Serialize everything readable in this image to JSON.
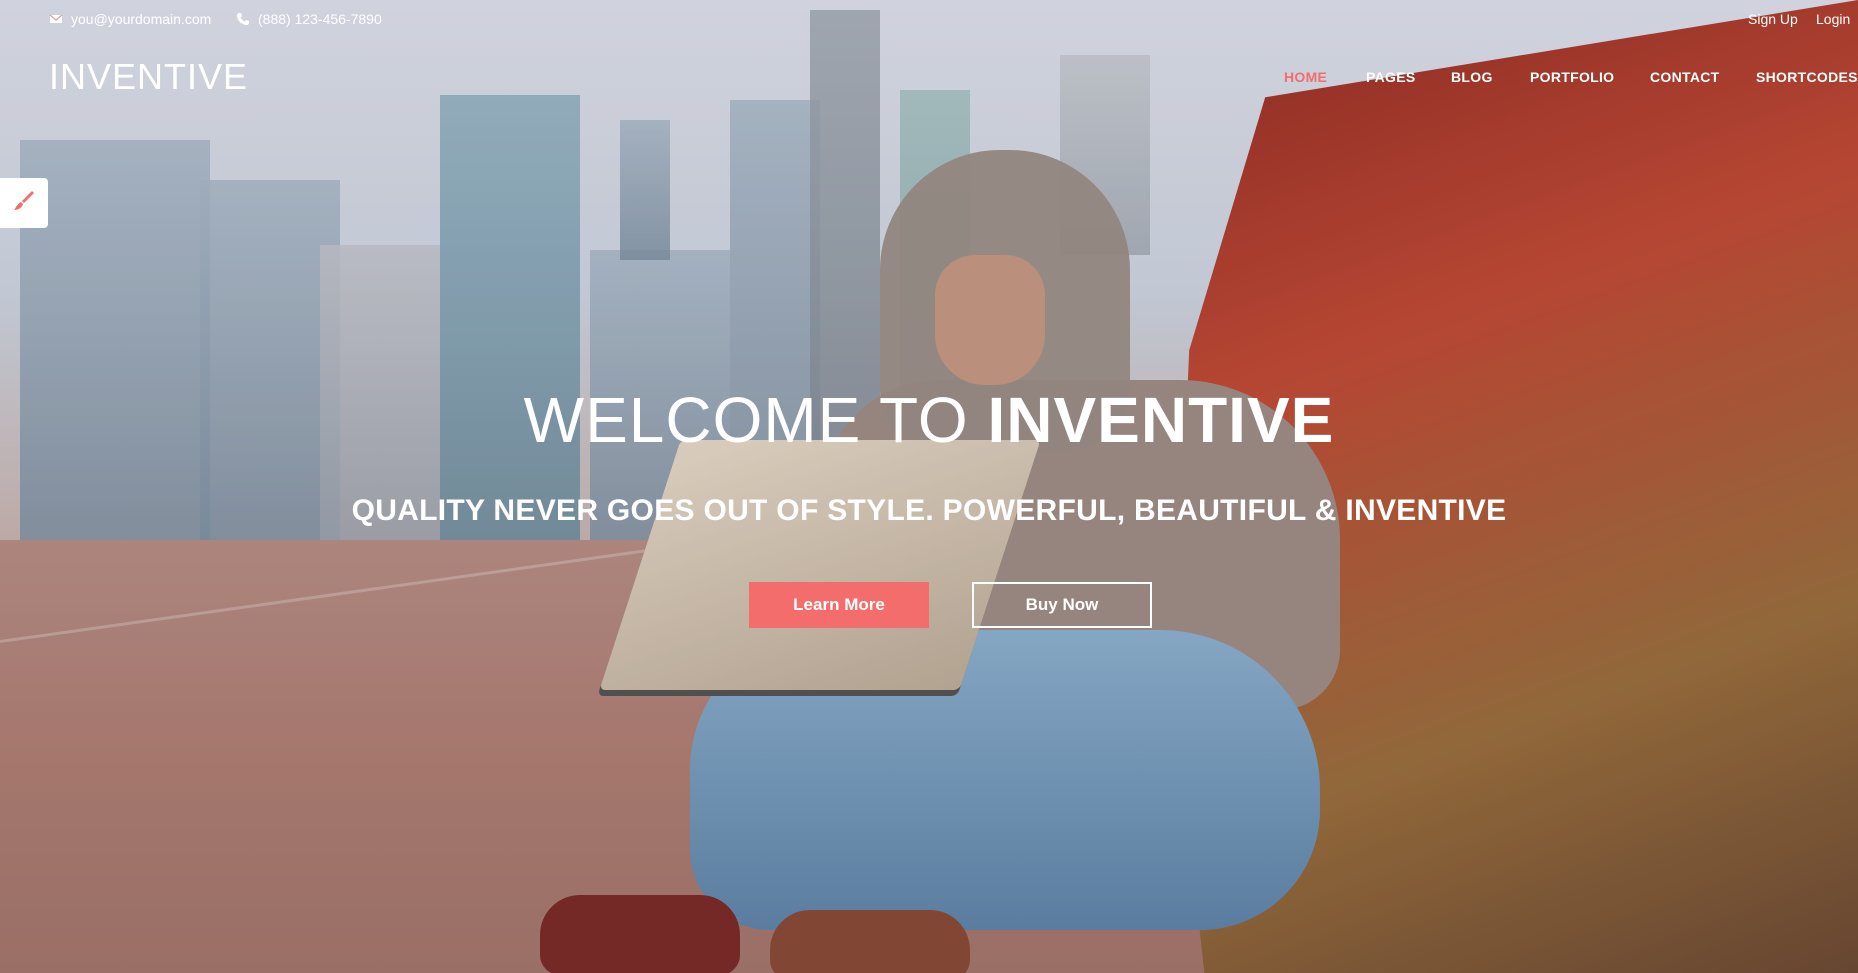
{
  "topbar": {
    "email": "you@yourdomain.com",
    "phone": "(888) 123-456-7890",
    "signup": "Sign Up",
    "login": "Login"
  },
  "brand": {
    "logo": "INVENTIVE"
  },
  "nav": {
    "items": [
      {
        "label": "HOME",
        "active": true
      },
      {
        "label": "PAGES",
        "active": false
      },
      {
        "label": "BLOG",
        "active": false
      },
      {
        "label": "PORTFOLIO",
        "active": false
      },
      {
        "label": "CONTACT",
        "active": false
      },
      {
        "label": "SHORTCODES",
        "active": false
      }
    ]
  },
  "hero": {
    "title_thin": "WELCOME TO",
    "title_bold": "INVENTIVE",
    "subtitle": "QUALITY NEVER GOES OUT OF STYLE. POWERFUL, BEAUTIFUL & INVENTIVE",
    "primary_button": "Learn More",
    "secondary_button": "Buy Now"
  },
  "icons": {
    "email": "envelope-icon",
    "phone": "phone-icon",
    "side_tool": "paintbrush-icon"
  },
  "colors": {
    "accent": "#f26d6b",
    "text_light": "#ffffff"
  }
}
